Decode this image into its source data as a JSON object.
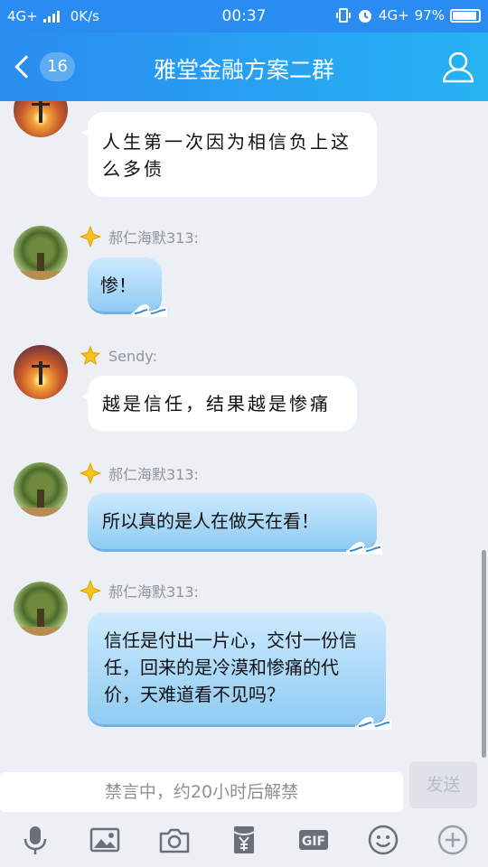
{
  "status": {
    "network_left": "4G+",
    "speed": "0K/s",
    "time": "00:37",
    "network_right": "4G+",
    "battery": "97%"
  },
  "header": {
    "back_badge": "16",
    "title": "雅堂金融方案二群"
  },
  "messages": [
    {
      "sender": "",
      "text": "人生第一次因为相信负上这么多债"
    },
    {
      "sender": "郝仁海默313:",
      "text": "惨！"
    },
    {
      "sender": "Sendy:",
      "text": "越是信任，结果越是惨痛"
    },
    {
      "sender": "郝仁海默313:",
      "text": "所以真的是人在做天在看！"
    },
    {
      "sender": "郝仁海默313:",
      "text": "信任是付出一片心，交付一份信任，回来的是冷漠和惨痛的代价，天难道看不见吗？"
    }
  ],
  "input": {
    "placeholder": "禁言中，约20小时后解禁",
    "send_label": "发送"
  },
  "toolbar": {
    "gif_label": "GIF"
  },
  "colors": {
    "accent": "#2a8cf0",
    "bubble_blue": "#9fd3f5",
    "muted_text": "#8f949c"
  }
}
